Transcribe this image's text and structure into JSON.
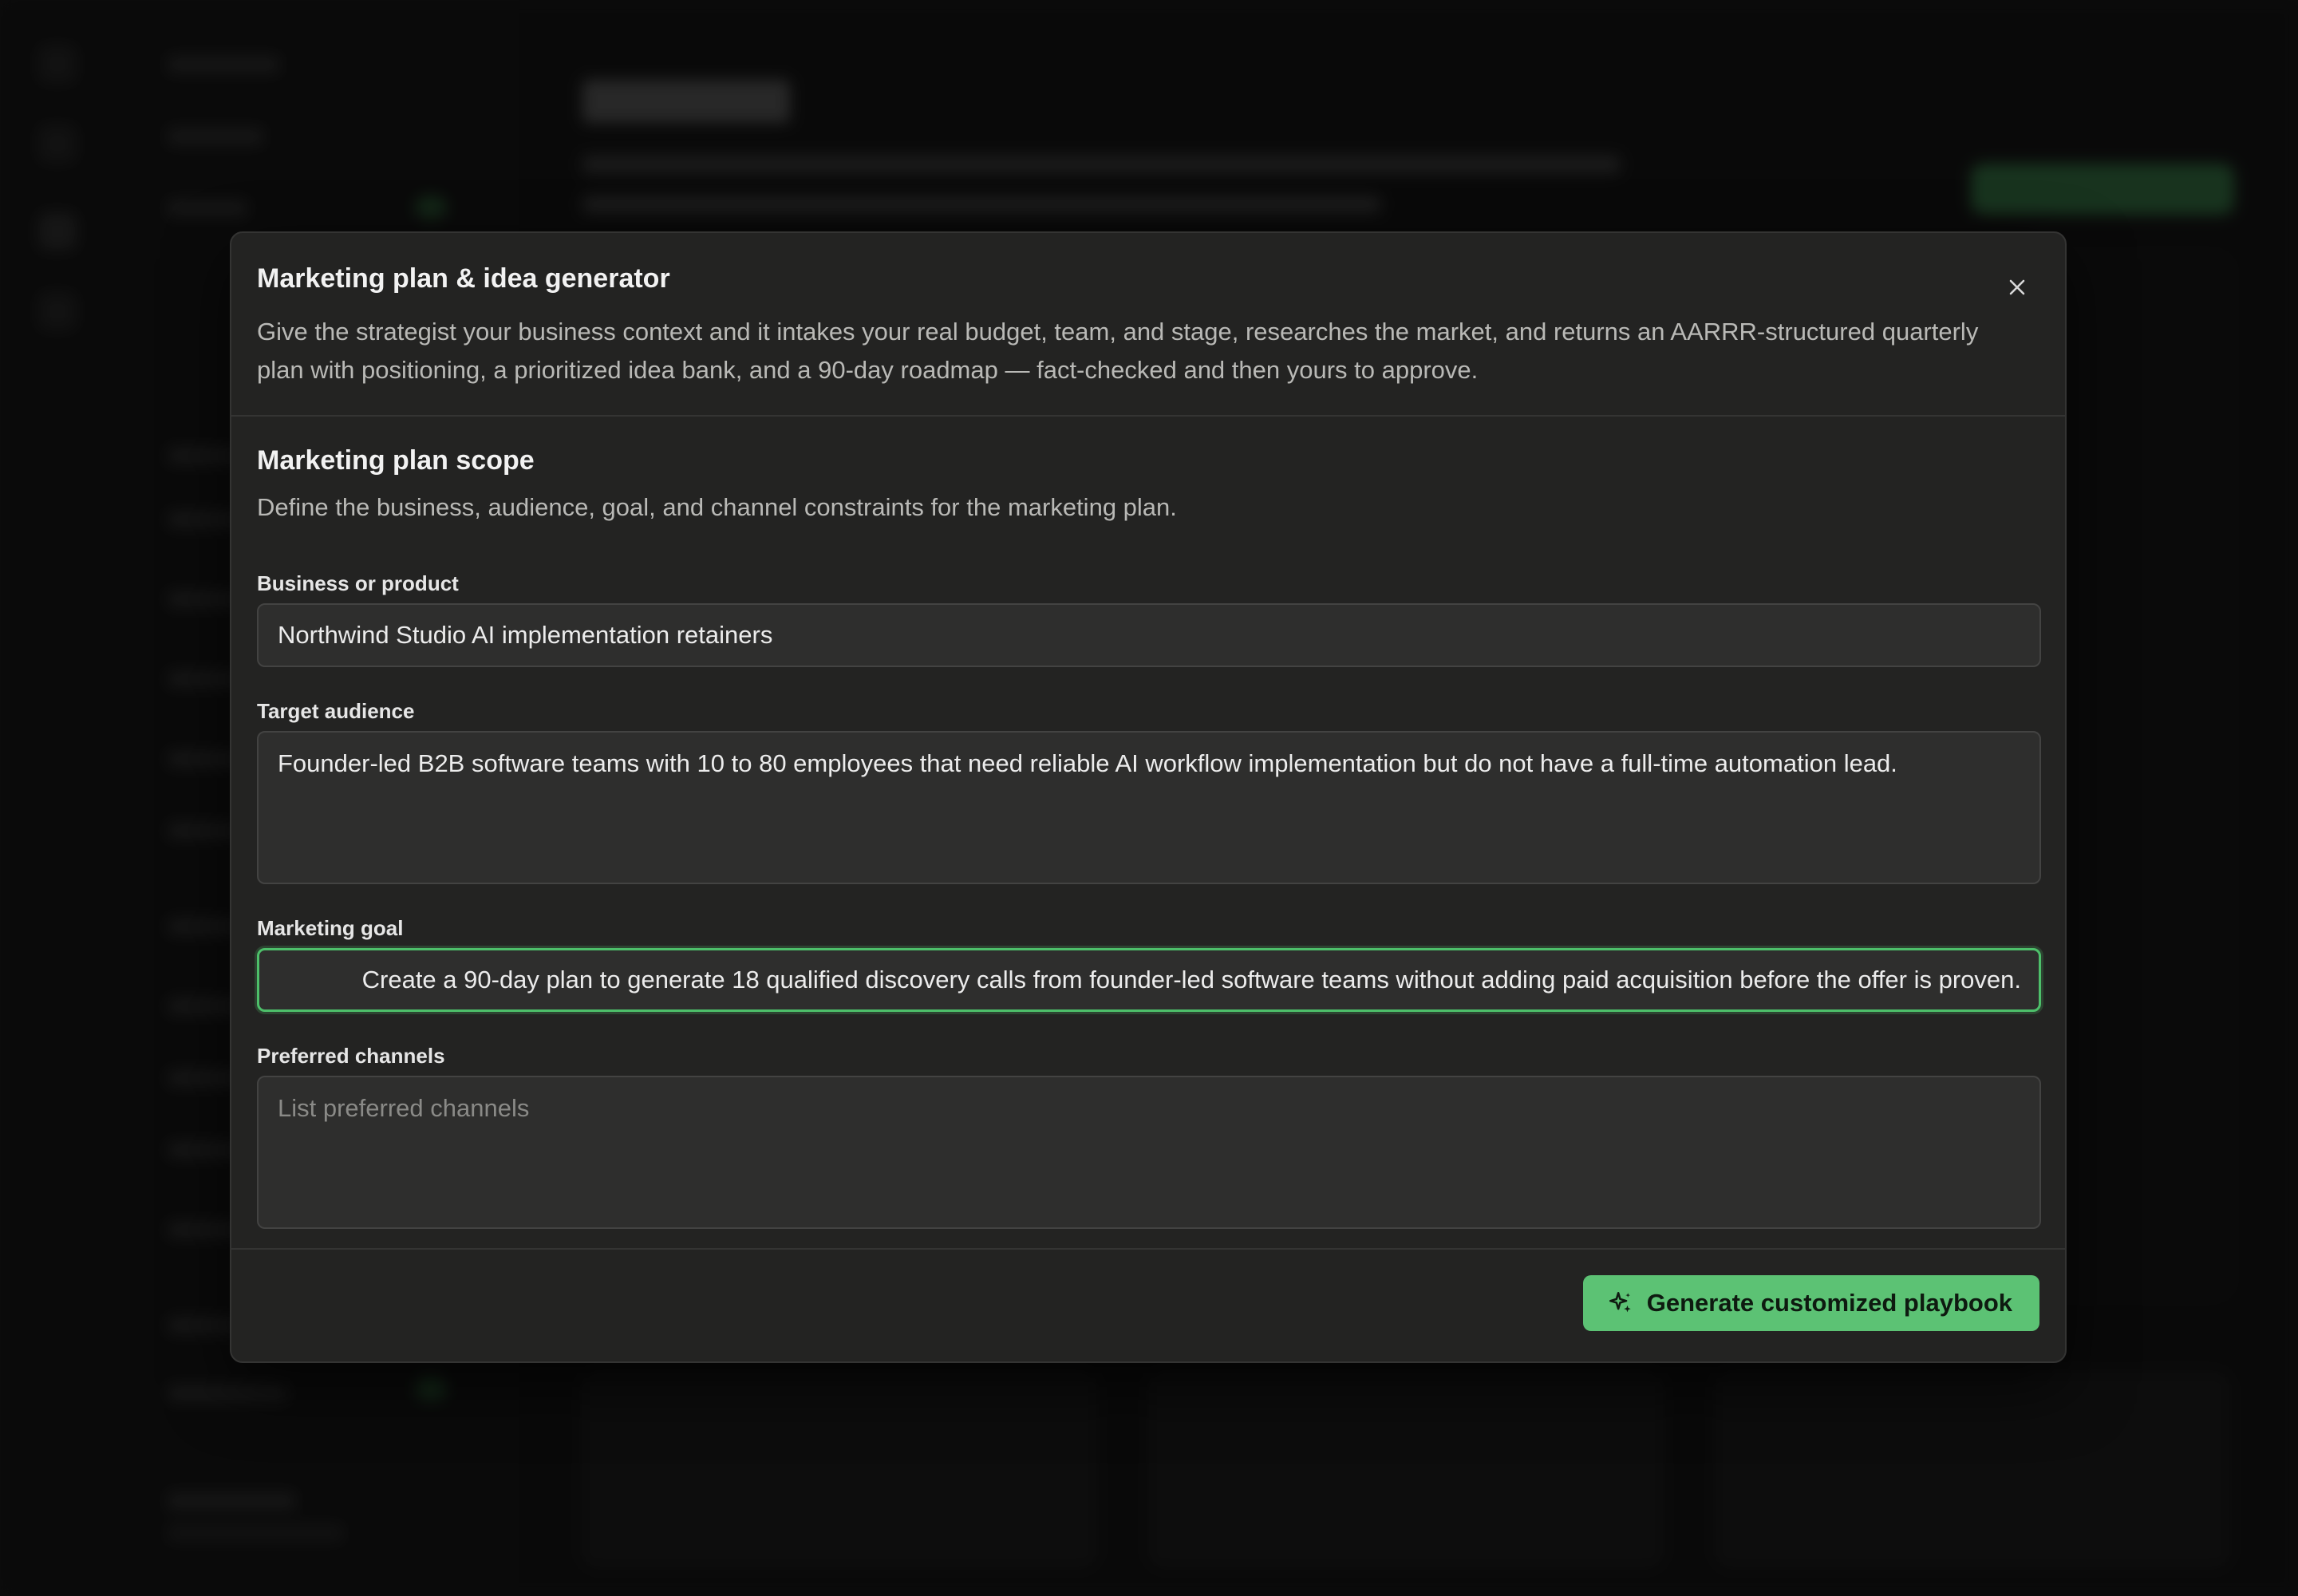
{
  "modal": {
    "title": "Marketing plan & idea generator",
    "description": "Give the strategist your business context and it intakes your real budget, team, and stage, researches the market, and returns an AARRR-structured quarterly plan with positioning, a prioritized idea bank, and a 90-day roadmap — fact-checked and then yours to approve.",
    "close_icon": "close-icon"
  },
  "section": {
    "title": "Marketing plan scope",
    "description": "Define the business, audience, goal, and channel constraints for the marketing plan."
  },
  "fields": {
    "business": {
      "label": "Business or product",
      "value": "Northwind Studio AI implementation retainers"
    },
    "audience": {
      "label": "Target audience",
      "value": "Founder-led B2B software teams with 10 to 80 employees that need reliable AI workflow implementation but do not have a full-time automation lead."
    },
    "goal": {
      "label": "Marketing goal",
      "value": "Create a 90-day plan to generate 18 qualified discovery calls from founder-led software teams without adding paid acquisition before the offer is proven."
    },
    "channels": {
      "label": "Preferred channels",
      "value": "",
      "placeholder": "List preferred channels"
    }
  },
  "footer": {
    "generate_label": "Generate customized playbook",
    "generate_icon": "sparkle-icon"
  },
  "colors": {
    "accent": "#5cc274",
    "focus_border": "#4dbf6a",
    "modal_bg": "#232322",
    "field_bg": "#2e2e2d"
  }
}
